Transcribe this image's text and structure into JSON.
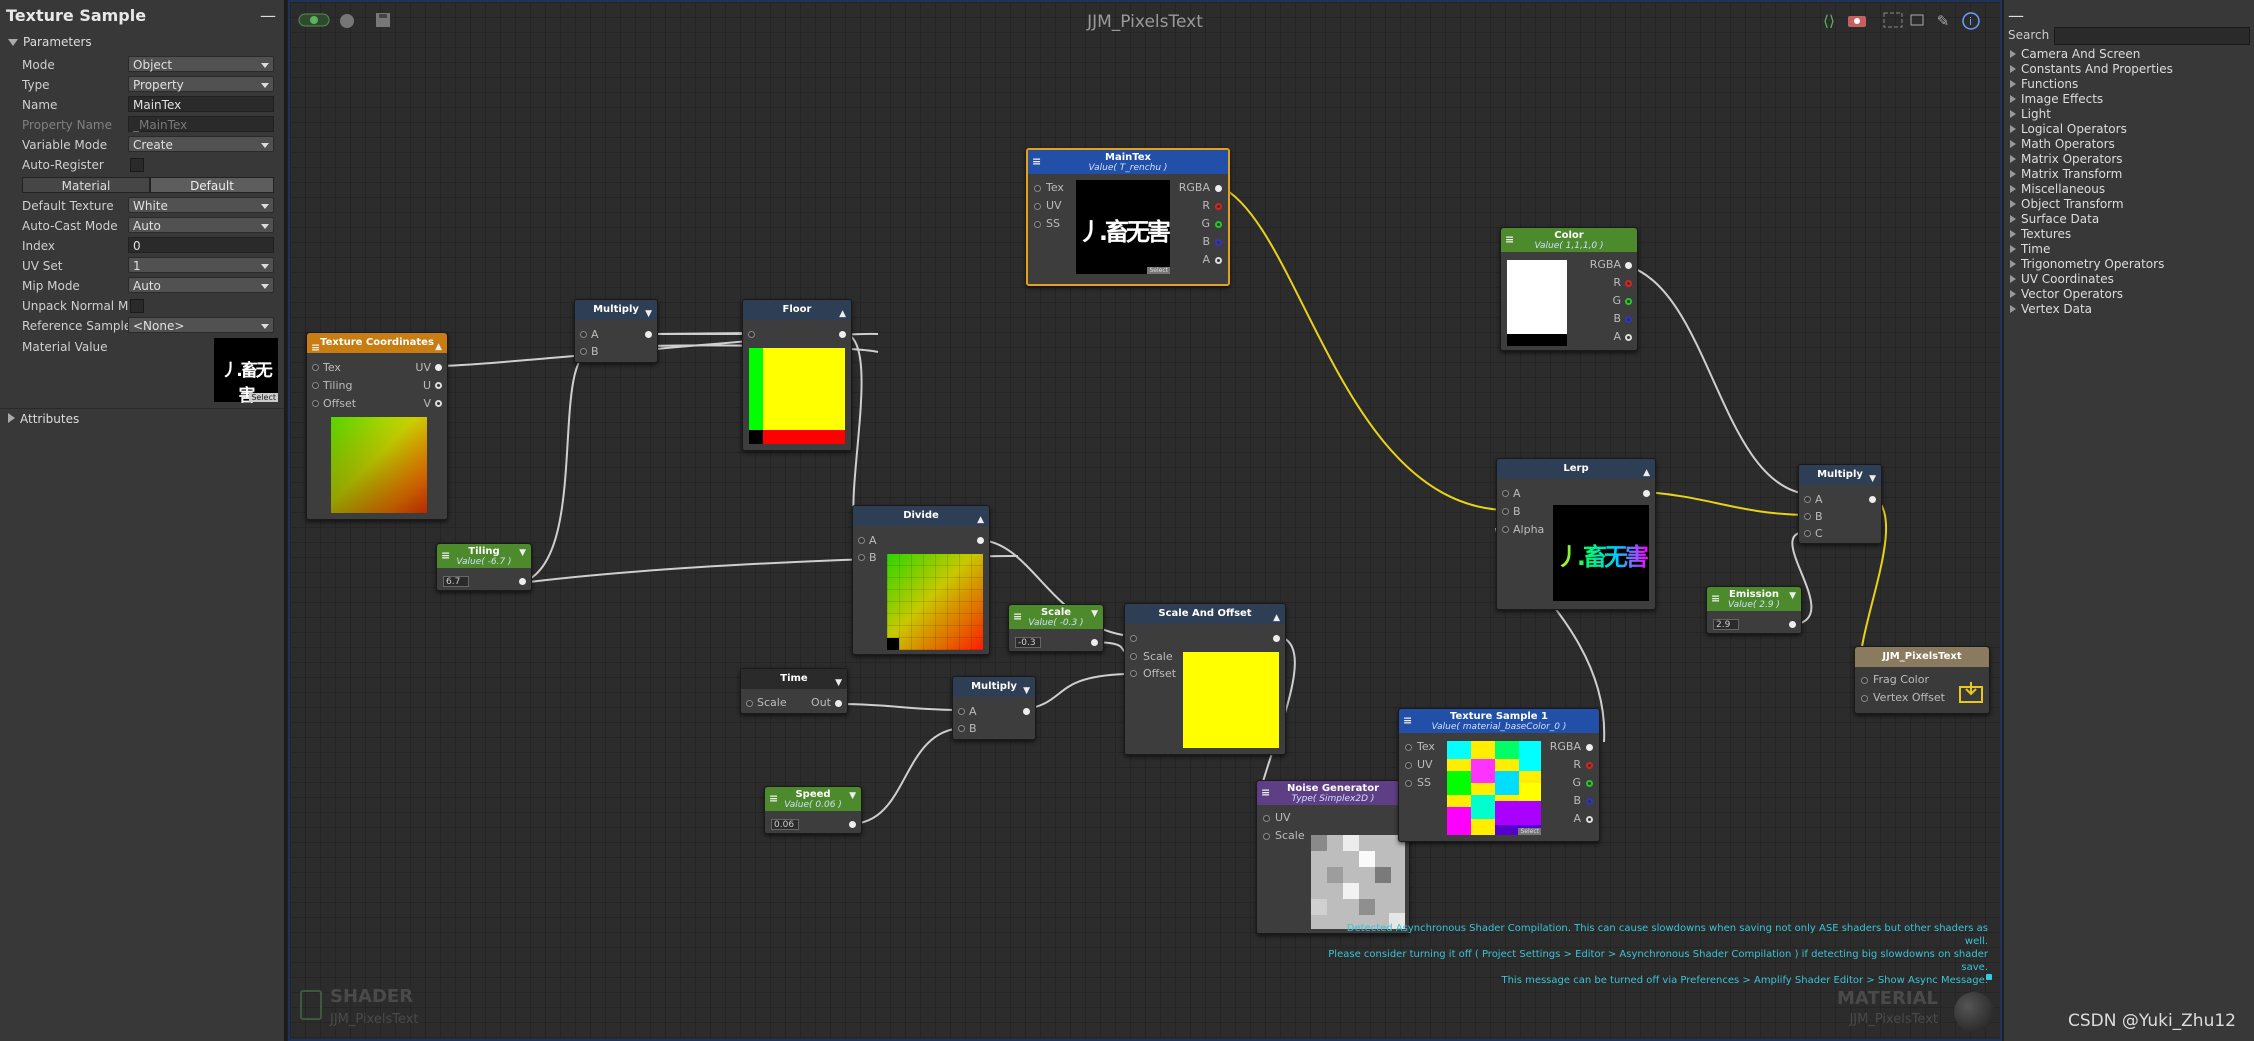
{
  "left_panel": {
    "title": "Texture Sample",
    "minimize": "—",
    "parameters_label": "Parameters",
    "attributes_label": "Attributes",
    "rows": {
      "mode": {
        "label": "Mode",
        "value": "Object"
      },
      "type": {
        "label": "Type",
        "value": "Property"
      },
      "name": {
        "label": "Name",
        "value": "MainTex"
      },
      "property_name": {
        "label": "Property Name",
        "value": "_MainTex"
      },
      "variable_mode": {
        "label": "Variable Mode",
        "value": "Create"
      },
      "auto_register": {
        "label": "Auto-Register"
      },
      "material_btn": "Material",
      "default_btn": "Default",
      "default_texture": {
        "label": "Default Texture",
        "value": "White"
      },
      "auto_cast_mode": {
        "label": "Auto-Cast Mode",
        "value": "Auto"
      },
      "index": {
        "label": "Index",
        "value": "0"
      },
      "uv_set": {
        "label": "UV Set",
        "value": "1"
      },
      "mip_mode": {
        "label": "Mip Mode",
        "value": "Auto"
      },
      "unpack_normal": {
        "label": "Unpack Normal Ma"
      },
      "reference_sample": {
        "label": "Reference Sample",
        "value": "<None>"
      },
      "material_value": {
        "label": "Material Value",
        "select": "Select"
      }
    },
    "texture_preview_text": "丿.畜无害"
  },
  "canvas": {
    "title": "JJM_PixelsText",
    "bottom_left_big": "SHADER",
    "bottom_left_small": "JJM_PixelsText",
    "bottom_right_big": "MATERIAL",
    "bottom_right_small": "JJM_PixelsText",
    "warning": [
      "Detected Asynchronous Shader Compilation. This can cause slowdowns when saving not only ASE shaders but other shaders as well.",
      "Please consider turning it off ( Project Settings > Editor > Asynchronous Shader Compilation ) if detecting big slowdowns on shader save.",
      "This message can be turned off via Preferences > Amplify Shader Editor > Show Async Message."
    ]
  },
  "nodes": {
    "texcoords": {
      "title": "Texture Coordinates",
      "ports_in": [
        "Tex",
        "Tiling",
        "Offset"
      ],
      "ports_out": [
        "UV",
        "U",
        "V"
      ]
    },
    "tiling": {
      "title": "Tiling",
      "sub": "Value( -6.7 )",
      "value": "6.7"
    },
    "multiply1": {
      "title": "Multiply",
      "a": "A",
      "b": "B"
    },
    "floor": {
      "title": "Floor"
    },
    "divide": {
      "title": "Divide",
      "a": "A",
      "b": "B"
    },
    "maintex": {
      "title": "MainTex",
      "sub": "Value( T_renchu )",
      "in": [
        "Tex",
        "UV",
        "SS"
      ],
      "out": [
        "RGBA",
        "R",
        "G",
        "B",
        "A"
      ],
      "preview_text": "丿.畜无害",
      "select": "Select"
    },
    "scale": {
      "title": "Scale",
      "sub": "Value( -0.3 )",
      "value": "-0.3"
    },
    "scale_offset": {
      "title": "Scale And Offset",
      "ports": [
        "Scale",
        "Offset"
      ]
    },
    "time": {
      "title": "Time",
      "scale": "Scale",
      "out": "Out"
    },
    "multiply2": {
      "title": "Multiply",
      "a": "A",
      "b": "B"
    },
    "speed": {
      "title": "Speed",
      "sub": "Value( 0.06 )",
      "value": "0.06"
    },
    "noise": {
      "title": "Noise Generator",
      "sub": "Type( Simplex2D )",
      "ports": [
        "UV",
        "Scale"
      ]
    },
    "color": {
      "title": "Color",
      "sub": "Value( 1,1,1,0 )",
      "out": [
        "RGBA",
        "R",
        "G",
        "B",
        "A"
      ]
    },
    "lerp": {
      "title": "Lerp",
      "ports": [
        "A",
        "B",
        "Alpha"
      ],
      "preview_text": "丿.畜无害"
    },
    "texsample1": {
      "title": "Texture Sample 1",
      "sub": "Value( material_baseColor_0 )",
      "in": [
        "Tex",
        "UV",
        "SS"
      ],
      "out": [
        "RGBA",
        "R",
        "G",
        "B",
        "A"
      ],
      "select": "Select"
    },
    "multiply3": {
      "title": "Multiply",
      "ports": [
        "A",
        "B",
        "C"
      ]
    },
    "emission": {
      "title": "Emission",
      "sub": "Value( 2.9 )",
      "value": "2.9"
    },
    "output": {
      "title": "JJM_PixelsText",
      "ports": [
        "Frag Color",
        "Vertex Offset"
      ]
    }
  },
  "right_panel": {
    "minimize": "—",
    "search_label": "Search",
    "categories": [
      "Camera And Screen",
      "Constants And Properties",
      "Functions",
      "Image Effects",
      "Light",
      "Logical Operators",
      "Math Operators",
      "Matrix Operators",
      "Matrix Transform",
      "Miscellaneous",
      "Object Transform",
      "Surface Data",
      "Textures",
      "Time",
      "Trigonometry Operators",
      "UV Coordinates",
      "Vector Operators",
      "Vertex Data"
    ]
  },
  "watermark": "CSDN @Yuki_Zhu12",
  "colors": {
    "accent": "#1f3358",
    "wire_yellow": "#e8d21a",
    "wire_white": "#cfcfcf"
  }
}
